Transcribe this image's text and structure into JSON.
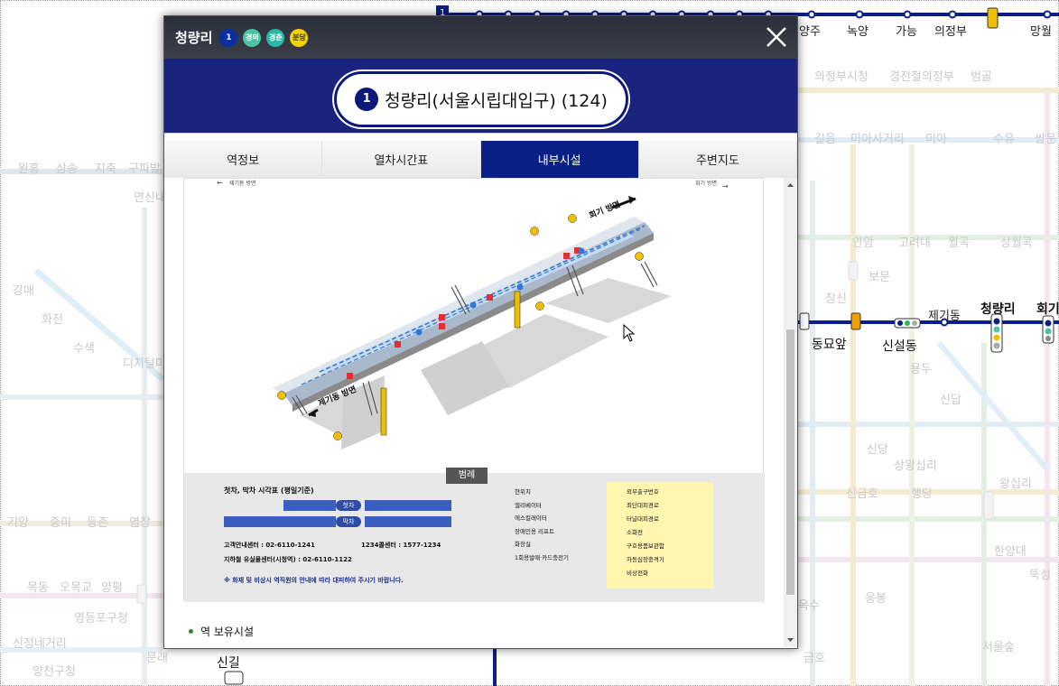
{
  "popup": {
    "station_name": "청량리",
    "line_badges": [
      {
        "label": "1",
        "color": "#0b2fa0"
      },
      {
        "label": "경의",
        "color": "#4cc3a3"
      },
      {
        "label": "경춘",
        "color": "#2ab8a8"
      },
      {
        "label": "분당",
        "color": "#f5d300"
      }
    ],
    "full_station_line": "1",
    "full_station_name": "청량리(서울시립대입구) (124)",
    "tabs": [
      "역정보",
      "열차시간표",
      "내부시설",
      "주변지도"
    ],
    "active_tab": "내부시설",
    "section_heading": "역 보유시설"
  },
  "diagram": {
    "dir_left": "제기동 방면",
    "dir_right": "회기 방면",
    "arrow_top": "회기 방면",
    "arrow_bottom": "제기동 방면",
    "legend_title": "범례",
    "timetable_title": "첫차, 막차 시각표 (평일기준)",
    "first_label": "첫차",
    "last_label": "막차",
    "info_center": "고객안내센터 : 02-6110-1241",
    "call_center": "1234콜센터 : 1577-1234",
    "lost_center": "지하철 유실물센터(시청역) : 02-6110-1122",
    "notice": "※ 화재 및 비상시 역직원의 안내에 따라 대피하여 주시기 바랍니다.",
    "legend_mid": [
      "현위치",
      "엘리베이터",
      "에스컬레이터",
      "장애인용 리프트",
      "화장실",
      "1회용발매·카드충전기"
    ],
    "legend_right": [
      "외부출구번호",
      "최단대피경로",
      "터널대피경로",
      "소화전",
      "구호용품보관함",
      "자동심장충격기",
      "비상전화"
    ]
  },
  "map": {
    "top_stations": [
      "양주",
      "녹양",
      "가능",
      "의정부",
      "망월"
    ],
    "faded_top": [
      "의정부시청",
      "경전철의정부",
      "범골"
    ],
    "faded": [
      "원흥",
      "삼송",
      "지축",
      "구파발",
      "연신내",
      "길음",
      "미아사거리",
      "미아",
      "수유",
      "쌍문",
      "안암",
      "고려대",
      "월곡",
      "상월곡",
      "보문",
      "창신",
      "강매",
      "화전",
      "수색",
      "디지털미디어시티",
      "용두",
      "신답",
      "신당",
      "상왕십리",
      "신금호",
      "행당",
      "왕십리",
      "한양대",
      "뚝섬",
      "기양",
      "증미",
      "등촌",
      "염창",
      "목동",
      "오목교",
      "양평",
      "영등포구청",
      "신정네거리",
      "양천구청",
      "문래",
      "서울숲",
      "응봉",
      "금호",
      "옥수"
    ],
    "line_stations": [
      "동묘앞",
      "신설동",
      "제기동",
      "청량리",
      "회기"
    ],
    "bottom_station": "신길"
  }
}
